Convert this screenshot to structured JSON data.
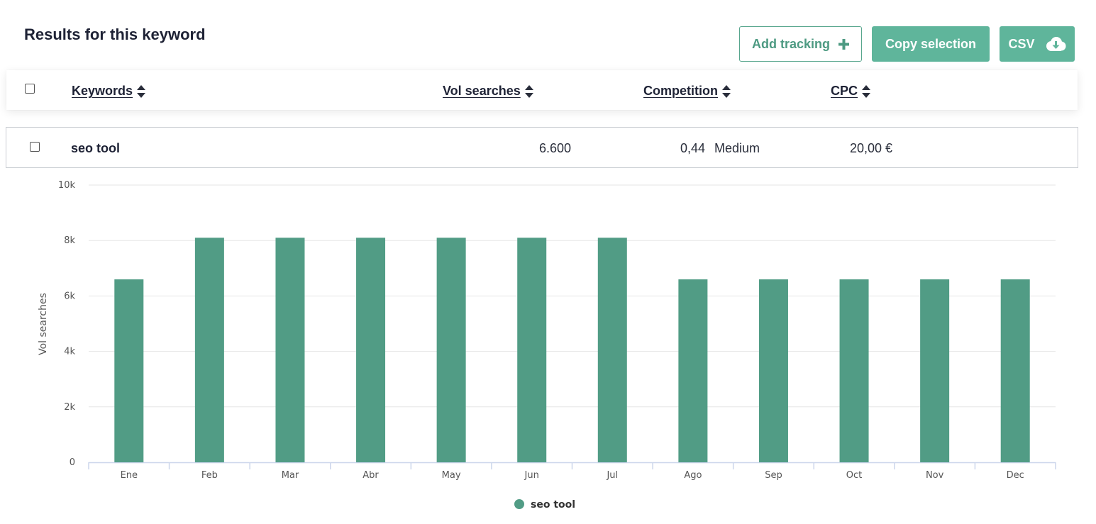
{
  "header": {
    "title": "Results for this keyword"
  },
  "toolbar": {
    "add_tracking_label": "Add tracking",
    "copy_selection_label": "Copy selection",
    "csv_label": "CSV",
    "accent_color": "#5fb59b"
  },
  "table": {
    "columns": {
      "keywords": "Keywords",
      "vol_searches": "Vol searches",
      "competition": "Competition",
      "cpc": "CPC"
    },
    "rows": [
      {
        "keyword": "seo tool",
        "vol_searches": "6.600",
        "competition_value": "0,44",
        "competition_level": "Medium",
        "cpc": "20,00 €"
      }
    ]
  },
  "chart_data": {
    "type": "bar",
    "categories": [
      "Ene",
      "Feb",
      "Mar",
      "Abr",
      "May",
      "Jun",
      "Jul",
      "Ago",
      "Sep",
      "Oct",
      "Nov",
      "Dec"
    ],
    "series": [
      {
        "name": "seo tool",
        "values": [
          6600,
          8100,
          8100,
          8100,
          8100,
          8100,
          8100,
          6600,
          6600,
          6600,
          6600,
          6600
        ],
        "color": "#519c85"
      }
    ],
    "ylabel": "Vol searches",
    "xlabel": "",
    "ylim": [
      0,
      10000
    ],
    "yticks": [
      0,
      2000,
      4000,
      6000,
      8000,
      10000
    ],
    "ytick_labels": [
      "0",
      "2k",
      "4k",
      "6k",
      "8k",
      "10k"
    ],
    "grid": true,
    "legend_position": "bottom-center"
  }
}
